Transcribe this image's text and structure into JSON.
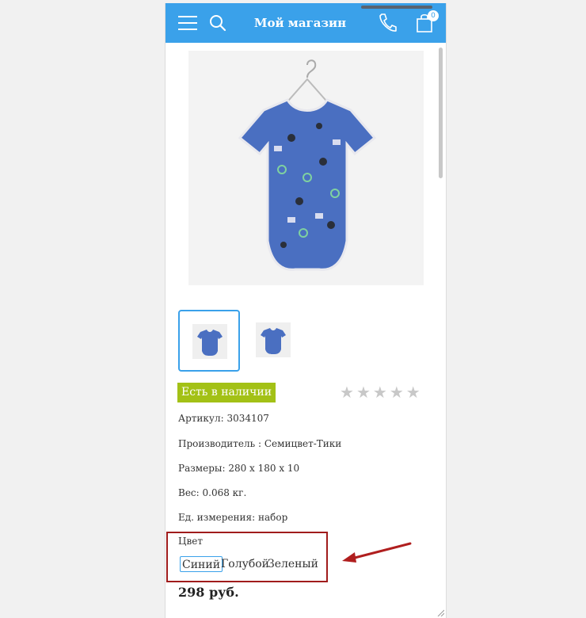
{
  "header": {
    "title": "Мой магазин",
    "cart_count": "0",
    "bg_color": "#3aa1ea"
  },
  "product": {
    "stock_label": "Есть в наличии",
    "rating_stars": 0,
    "rating_max": 5,
    "fields": [
      {
        "label": "Артикул:",
        "value": "3034107"
      },
      {
        "label": "Производитель :",
        "value": "Семицвет-Тики"
      },
      {
        "label": "Размеры:",
        "value": "280 x 180 x 10"
      },
      {
        "label": "Вес:",
        "value": "0.068 кг."
      },
      {
        "label": "Ед. измерения:",
        "value": "набор"
      }
    ],
    "color_label": "Цвет",
    "colors": [
      "Синий",
      "Голубой",
      "Зеленый"
    ],
    "selected_color": "Синий",
    "price": "298 руб."
  },
  "icons": {
    "menu": "hamburger-icon",
    "search": "search-icon",
    "phone": "phone-icon",
    "cart": "shopping-bag-icon",
    "star": "star-icon"
  }
}
